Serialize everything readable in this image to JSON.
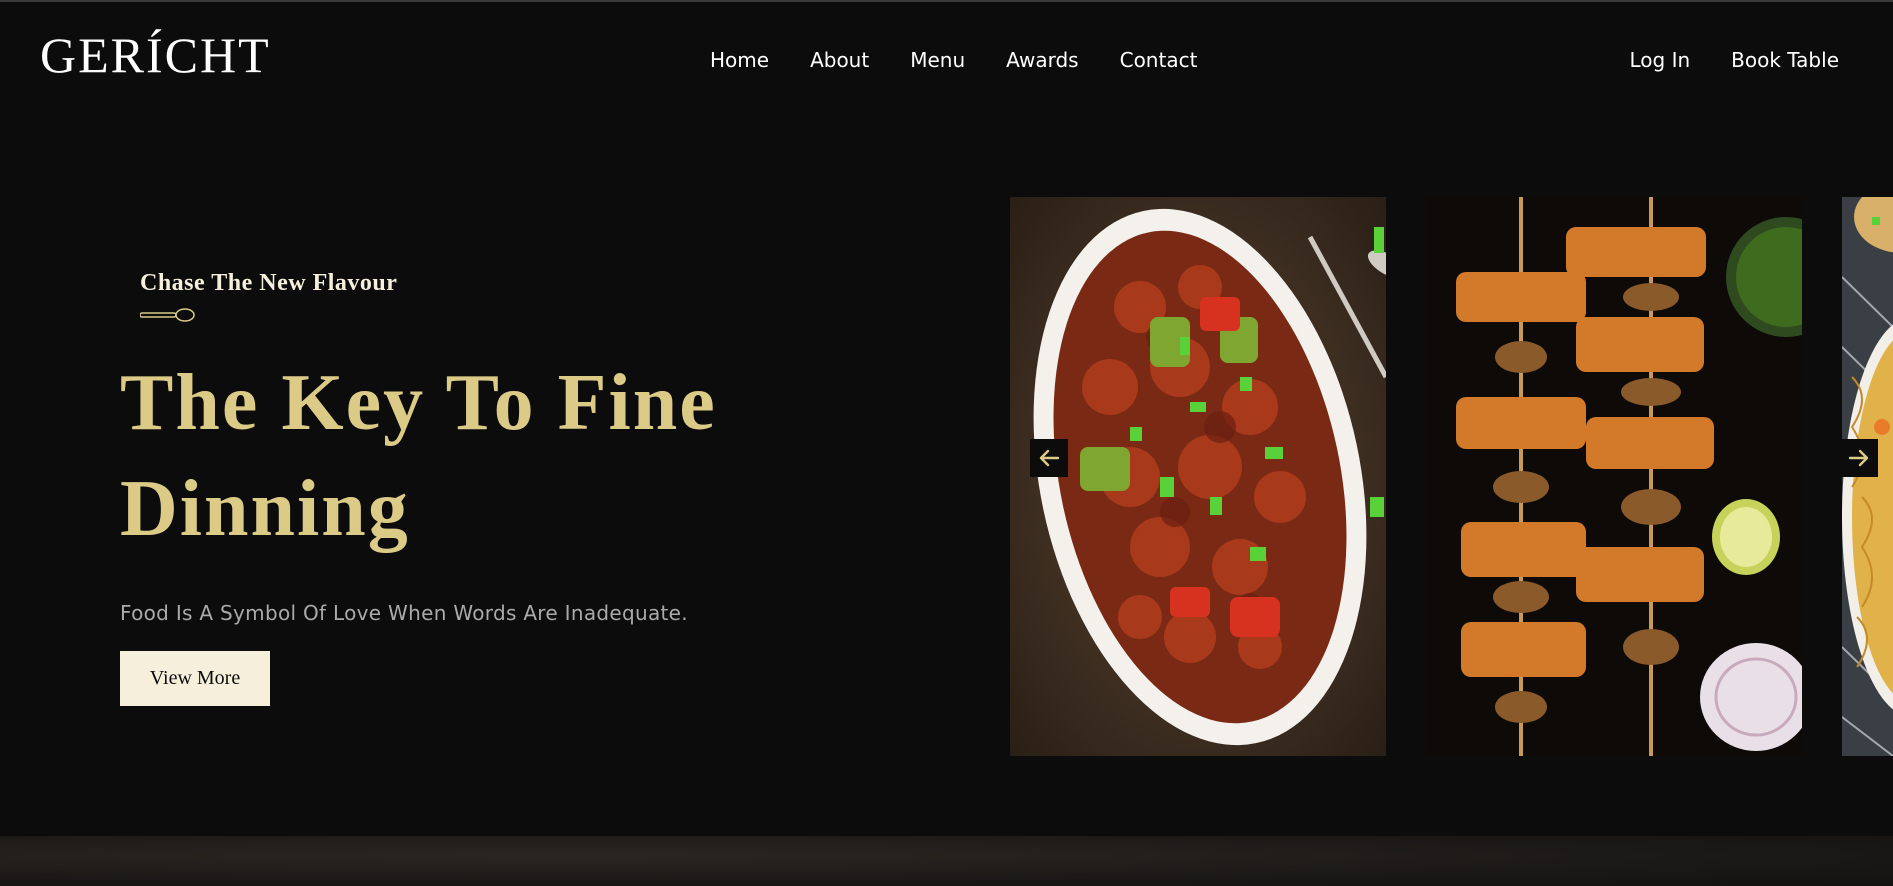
{
  "brand": {
    "logo": "GERÍCHT"
  },
  "nav": {
    "links": [
      "Home",
      "About",
      "Menu",
      "Awards",
      "Contact"
    ],
    "login": "Log In",
    "book": "Book Table"
  },
  "hero": {
    "subtitle": "Chase The New Flavour",
    "heading_line1": "The Key To Fine",
    "heading_line2": "Dinning",
    "tagline": "Food Is A Symbol Of Love When Words Are Inadequate.",
    "cta": "View More"
  },
  "gallery": {
    "images": [
      "chilli-paneer-dish",
      "paneer-tikka-skewers",
      "noodles-dish"
    ],
    "prev_icon": "arrow-left-icon",
    "next_icon": "arrow-right-icon"
  },
  "colors": {
    "background": "#0c0c0c",
    "golden": "#dcca87",
    "crimson_white": "#f5efdb",
    "grey": "#aaaaaa"
  }
}
